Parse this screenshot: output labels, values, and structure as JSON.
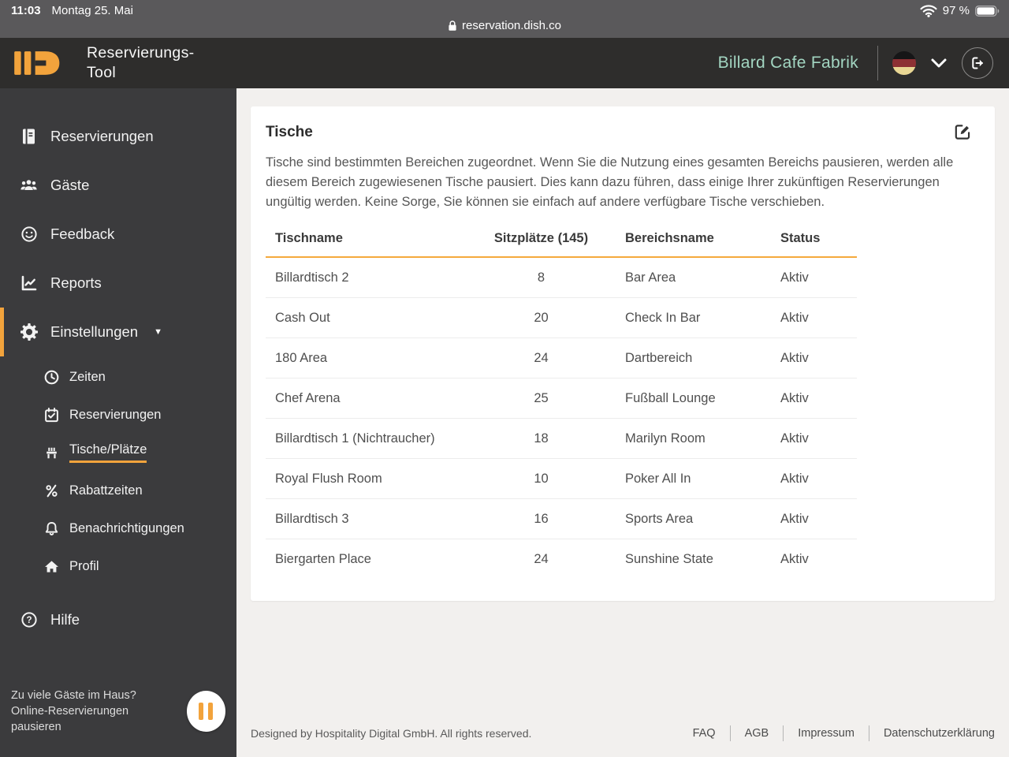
{
  "status_bar": {
    "time": "11:03",
    "date": "Montag 25. Mai",
    "url": "reservation.dish.co",
    "battery_percent": "97 %"
  },
  "header": {
    "app_title": "Reservierungs-\nTool",
    "restaurant": "Billard Cafe Fabrik"
  },
  "sidebar": {
    "items": [
      {
        "label": "Reservierungen"
      },
      {
        "label": "Gäste"
      },
      {
        "label": "Feedback"
      },
      {
        "label": "Reports"
      },
      {
        "label": "Einstellungen"
      }
    ],
    "settings_subitems": [
      {
        "label": "Zeiten"
      },
      {
        "label": "Reservierungen"
      },
      {
        "label": "Tische/Plätze"
      },
      {
        "label": "Rabattzeiten"
      },
      {
        "label": "Benachrichtigungen"
      },
      {
        "label": "Profil"
      }
    ],
    "help_label": "Hilfe",
    "pause_text": "Zu viele Gäste im Haus? Online-Reservierungen pausieren"
  },
  "main": {
    "card": {
      "title": "Tische",
      "description": "Tische sind bestimmten Bereichen zugeordnet. Wenn Sie die Nutzung eines gesamten Bereichs pausieren, werden alle diesem Bereich zugewiesenen Tische pausiert. Dies kann dazu führen, dass einige Ihrer zukünftigen Reservierungen ungültig werden. Keine Sorge, Sie können sie einfach auf andere verfügbare Tische verschieben."
    },
    "table": {
      "headers": [
        "Tischname",
        "Sitzplätze (145)",
        "Bereichsname",
        "Status"
      ],
      "rows": [
        {
          "name": "Billardtisch 2",
          "seats": "8",
          "area": "Bar Area",
          "status": "Aktiv"
        },
        {
          "name": "Cash Out",
          "seats": "20",
          "area": "Check In Bar",
          "status": "Aktiv"
        },
        {
          "name": "180 Area",
          "seats": "24",
          "area": "Dartbereich",
          "status": "Aktiv"
        },
        {
          "name": "Chef Arena",
          "seats": "25",
          "area": "Fußball Lounge",
          "status": "Aktiv"
        },
        {
          "name": "Billardtisch 1 (Nichtraucher)",
          "seats": "18",
          "area": "Marilyn Room",
          "status": "Aktiv"
        },
        {
          "name": "Royal Flush Room",
          "seats": "10",
          "area": "Poker All In",
          "status": "Aktiv"
        },
        {
          "name": "Billardtisch 3",
          "seats": "16",
          "area": "Sports Area",
          "status": "Aktiv"
        },
        {
          "name": "Biergarten Place",
          "seats": "24",
          "area": "Sunshine State",
          "status": "Aktiv"
        }
      ]
    }
  },
  "footer": {
    "copyright": "Designed by Hospitality Digital GmbH. All rights reserved.",
    "links": [
      "FAQ",
      "AGB",
      "Impressum",
      "Datenschutzerklärung"
    ]
  },
  "colors": {
    "accent_orange": "#F2A33C",
    "header_bg": "#2E2D2C",
    "sidebar_bg": "#3B3B3D",
    "status_bar_bg": "#5A595B",
    "restaurant_name_teal": "#A3D6C2",
    "content_bg": "#F2F0EE",
    "table_rule_orange": "#F5A93C"
  }
}
